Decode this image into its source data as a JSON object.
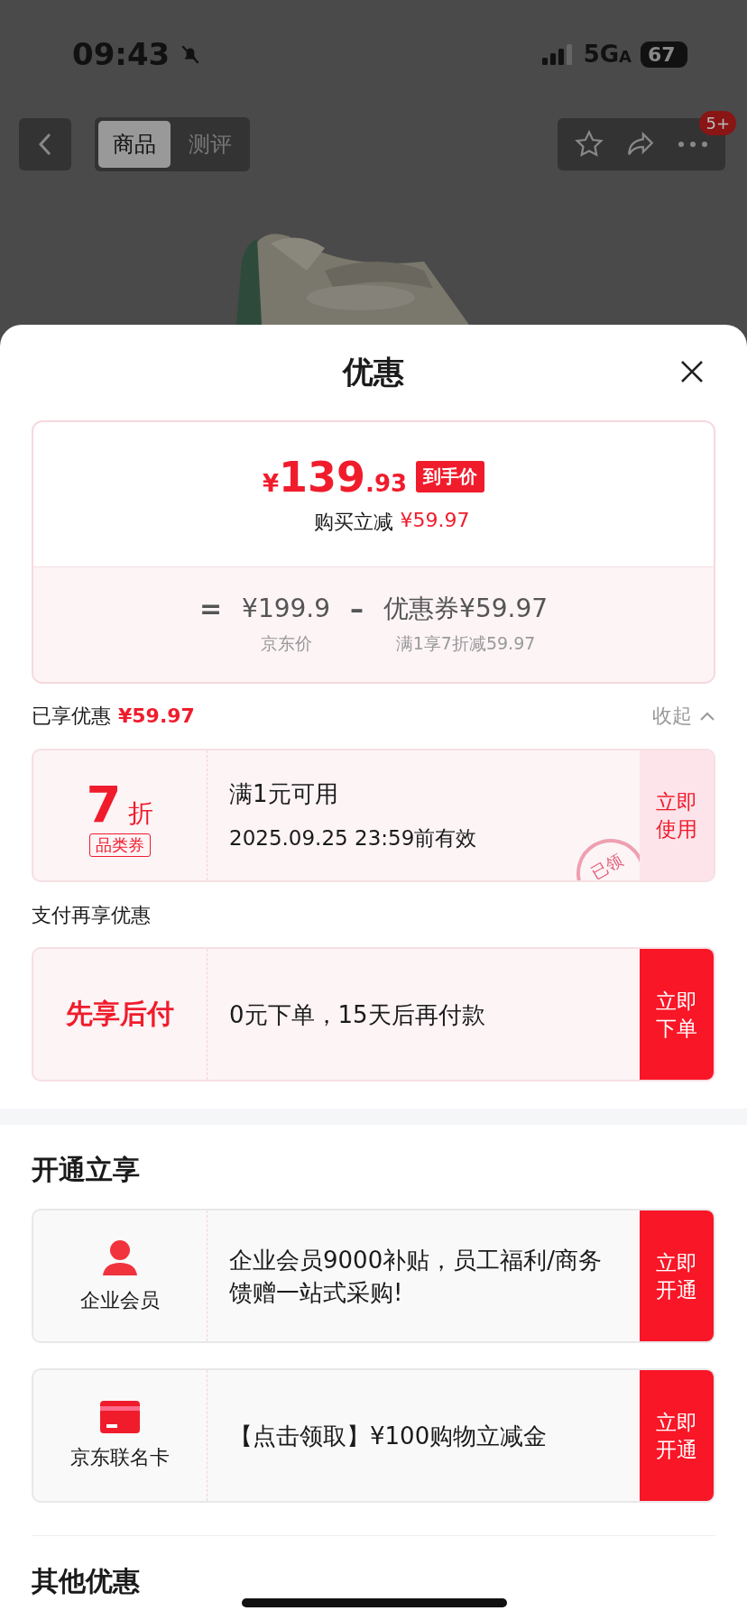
{
  "status_bar": {
    "time": "09:43",
    "network": "5G",
    "network_suffix": "A",
    "battery": "67"
  },
  "nav": {
    "tabs": [
      {
        "label": "商品",
        "selected": true
      },
      {
        "label": "测评",
        "selected": false
      }
    ],
    "badge": "5+"
  },
  "sheet": {
    "title": "优惠",
    "price": {
      "currency": "¥",
      "integer": "139",
      "decimal": ".93",
      "tag": "到手价",
      "saving_label": "购买立减",
      "saving": "¥59.97",
      "formula": {
        "equals": "=",
        "base": "¥199.9",
        "base_label": "京东价",
        "minus": "–",
        "coupon": "优惠券¥59.97",
        "coupon_label": "满1享7折减59.97"
      }
    },
    "enjoyed": {
      "label": "已享优惠",
      "amount": "¥59.97",
      "toggle": "收起",
      "expanded": true
    },
    "coupons": [
      {
        "value": "7",
        "unit": "折",
        "type": "品类券",
        "condition": "满1元可用",
        "validity": "2025.09.25 23:59前有效",
        "stamp": "已领",
        "action": "立即使用"
      }
    ],
    "pay_title": "支付再享优惠",
    "pay_offers": [
      {
        "name": "先享后付",
        "text": "0元下单，15天后再付款",
        "action": "立即下单"
      }
    ],
    "open_title": "开通立享",
    "open_offers": [
      {
        "kind": "member",
        "name": "企业会员",
        "text": "企业会员9000补贴，员工福利/商务馈赠一站式采购!",
        "action": "立即开通"
      },
      {
        "kind": "card",
        "name": "京东联名卡",
        "text": "【点击领取】¥100购物立减金",
        "action": "立即开通"
      }
    ],
    "other_title": "其他优惠"
  }
}
